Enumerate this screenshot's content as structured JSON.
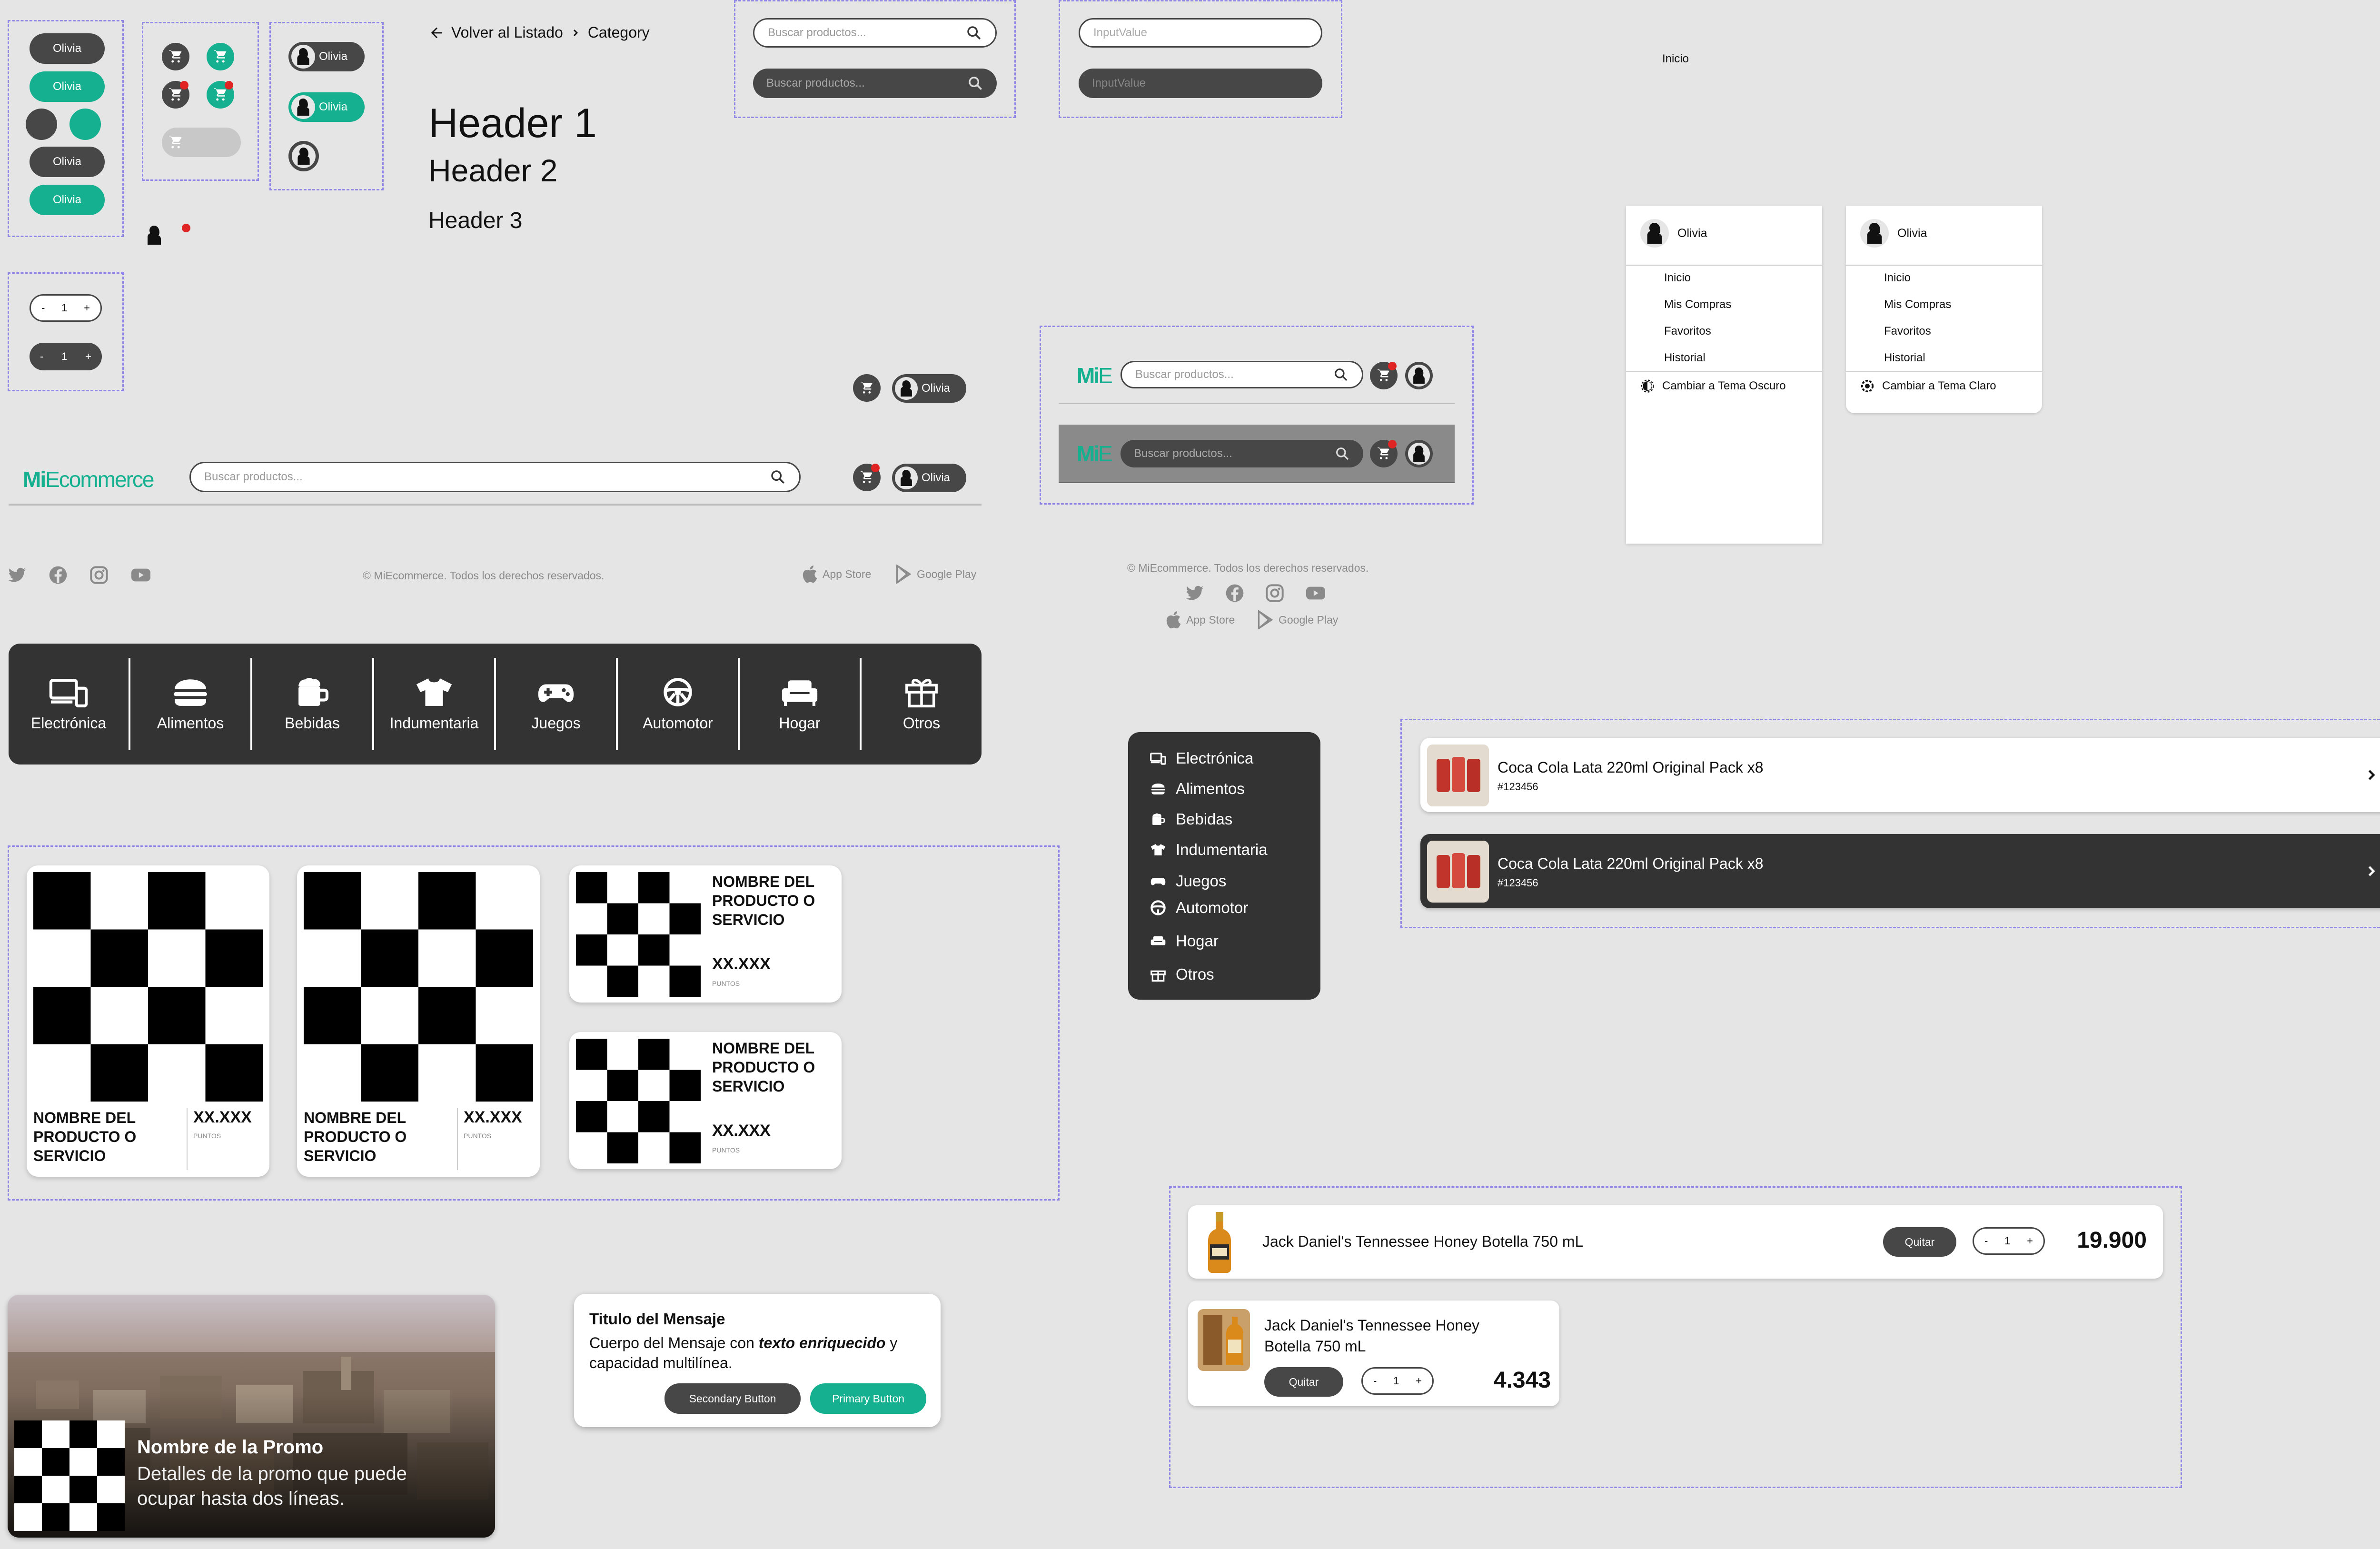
{
  "user": {
    "name": "Olivia"
  },
  "breadcrumb": {
    "back": "Volver al Listado",
    "category": "Category"
  },
  "headers": {
    "h1": "Header 1",
    "h2": "Header 2",
    "h3": "Header 3"
  },
  "search": {
    "placeholder": "Buscar productos..."
  },
  "input": {
    "placeholder": "InputValue"
  },
  "nav_label": "Inicio",
  "stepper": {
    "minus": "-",
    "value": "1",
    "plus": "+"
  },
  "brand": {
    "full_mi": "Mi",
    "full_rest": "Ecommerce",
    "short_mi": "Mi",
    "short_e": "E"
  },
  "user_menu": {
    "items": [
      "Inicio",
      "Mis Compras",
      "Favoritos",
      "Historial"
    ],
    "theme_dark": "Cambiar a Tema Oscuro",
    "theme_light": "Cambiar a Tema Claro"
  },
  "footer": {
    "copyright": "© MiEcommerce. Todos los derechos reservados.",
    "app_store": "App Store",
    "google_play": "Google Play"
  },
  "categories": [
    "Electrónica",
    "Alimentos",
    "Bebidas",
    "Indumentaria",
    "Juegos",
    "Automotor",
    "Hogar",
    "Otros"
  ],
  "product": {
    "name": "NOMBRE DEL PRODUCTO O SERVICIO",
    "price": "XX.XXX",
    "points": "PUNTOS"
  },
  "order": {
    "title": "Coca Cola Lata 220ml Original Pack x8",
    "id": "#123456"
  },
  "cart": {
    "item_name": "Jack Daniel's Tennessee Honey Botella 750 mL",
    "remove": "Quitar",
    "price_1": "19.900",
    "price_2": "4.343"
  },
  "promo": {
    "title": "Nombre de la Promo",
    "details": "Detalles de la promo que puede ocupar hasta dos líneas."
  },
  "message": {
    "title": "Titulo del Mensaje",
    "body_1": "Cuerpo del Mensaje con ",
    "body_em": "texto enriquecido",
    "body_2": " y capacidad multilínea.",
    "secondary": "Secondary Button",
    "primary": "Primary Button"
  },
  "colors": {
    "accent": "#14b08f",
    "dark": "#474747",
    "panel": "#333333",
    "badge": "#e02424",
    "background": "#e5e5e5",
    "dash": "#8f86e6"
  }
}
